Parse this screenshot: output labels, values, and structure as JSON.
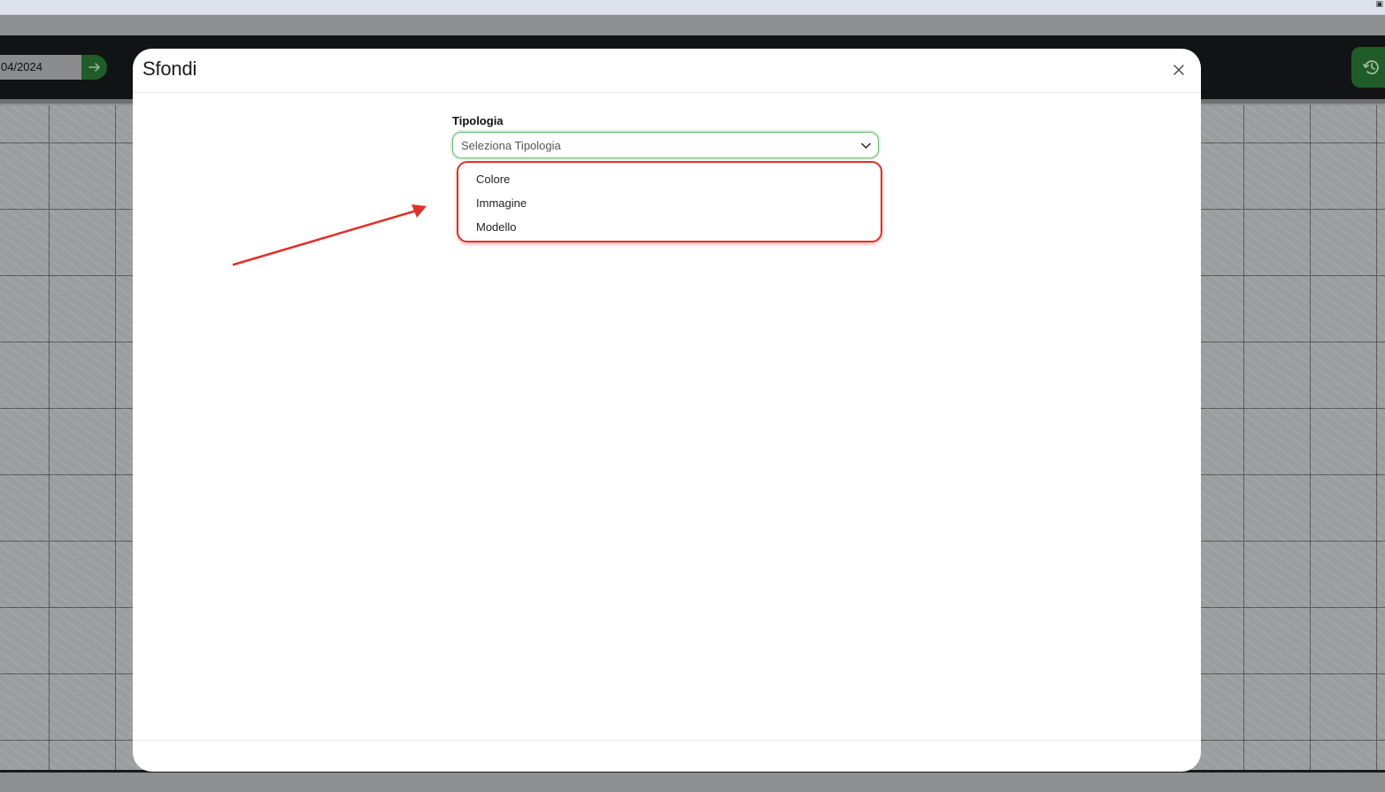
{
  "header": {
    "date_value": "04/2024"
  },
  "modal": {
    "title": "Sfondi",
    "field": {
      "label": "Tipologia",
      "placeholder": "Seleziona Tipologia",
      "options": [
        "Colore",
        "Immagine",
        "Modello"
      ]
    }
  },
  "colors": {
    "accent_green": "#1f5c28",
    "focus_border": "#6dbb73",
    "annotation_red": "#e0302a"
  },
  "icons": {
    "date_go": "arrow-right-icon",
    "history": "history-icon",
    "close": "close-icon",
    "select": "chevron-down-icon"
  }
}
